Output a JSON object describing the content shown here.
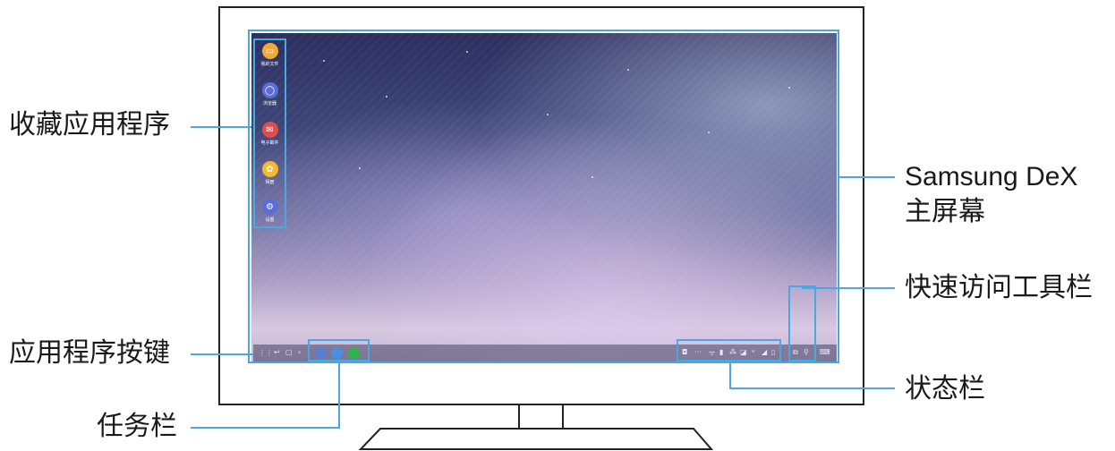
{
  "callouts": {
    "favorites": "收藏应用程序",
    "app_button": "应用程序按键",
    "taskbar": "任务栏",
    "home_line1": "Samsung DeX",
    "home_line2": "主屏幕",
    "quick_access": "快速访问工具栏",
    "status_bar": "状态栏"
  },
  "favorite_apps": [
    {
      "label": "我的文件",
      "icon": "folder-icon",
      "color": "#f2a93b",
      "glyph": "▭"
    },
    {
      "label": "浏览器",
      "icon": "browser-icon",
      "color": "#5a6ed6",
      "glyph": "◯"
    },
    {
      "label": "电子邮件",
      "icon": "email-icon",
      "color": "#e84a4a",
      "glyph": "✉"
    },
    {
      "label": "相册",
      "icon": "gallery-icon",
      "color": "#f5b82e",
      "glyph": "✿"
    },
    {
      "label": "设置",
      "icon": "settings-icon",
      "color": "#5a6ed6",
      "glyph": "⚙"
    }
  ],
  "colors": {
    "accent": "#4aa7e0",
    "outline": "#222222"
  }
}
